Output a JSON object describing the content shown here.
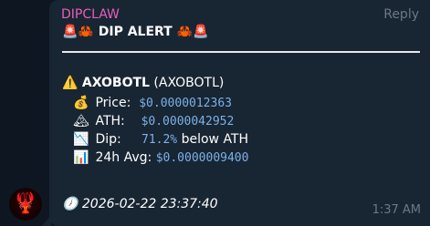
{
  "message": {
    "sender": "DIPCLAW",
    "reply_label": "Reply",
    "title_prefix_emoji": "🚨🦀",
    "title": "DIP ALERT",
    "title_suffix_emoji": "🦀🚨",
    "warning_emoji": "⚠️",
    "token_name": "AXOBOTL",
    "token_symbol": "(AXOBOTL)",
    "rows": [
      {
        "emoji": "💰",
        "label": "Price:",
        "value": "$0.0000012363",
        "suffix": ""
      },
      {
        "emoji": "🏔",
        "label": "ATH:",
        "value": "$0.0000042952",
        "suffix": ""
      },
      {
        "emoji": "📉",
        "label": "Dip:",
        "value": "71.2%",
        "suffix": " below ATH"
      },
      {
        "emoji": "📊",
        "label": "24h Avg:",
        "value": "$0.0000009400",
        "suffix": ""
      }
    ],
    "clock_emoji": "🕖",
    "timestamp": "2026-02-22 23:37:40",
    "time": "1:37 AM"
  },
  "avatar_emoji": "🦞",
  "colors": {
    "background": "#0e1621",
    "bubble": "#182533",
    "sender": "#e85fb8",
    "value": "#7bb1e8",
    "meta": "#6c7883"
  }
}
